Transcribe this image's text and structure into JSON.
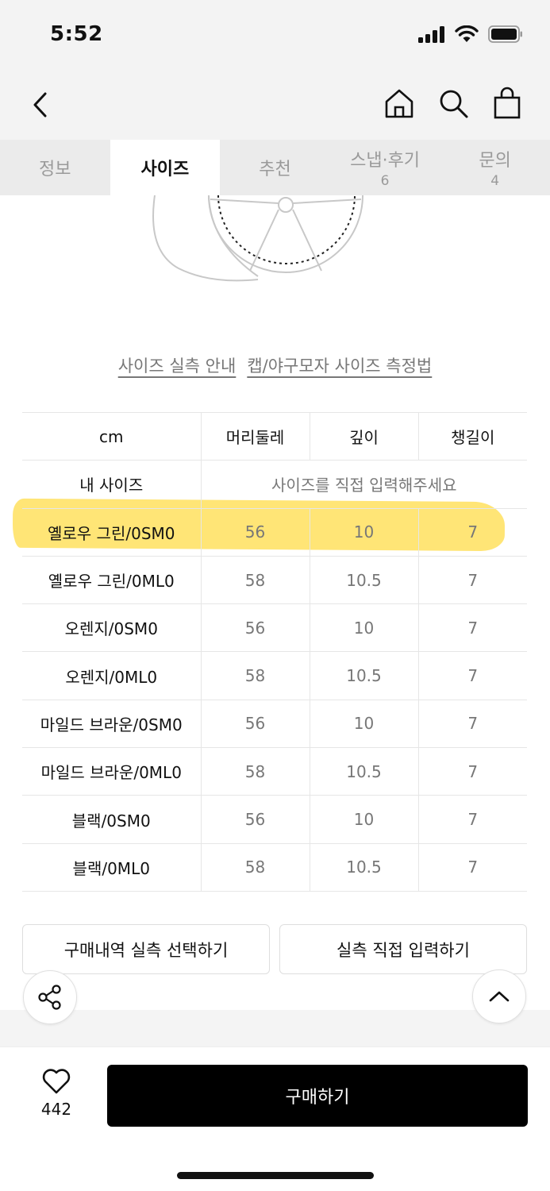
{
  "status_bar": {
    "time": "5:52",
    "icons": [
      "signal-icon",
      "wifi-icon",
      "battery-icon"
    ]
  },
  "nav": {
    "icons": [
      "back-chevron-icon",
      "home-icon",
      "search-icon",
      "shopping-bag-icon"
    ]
  },
  "tabs": [
    {
      "label": "정보",
      "count": ""
    },
    {
      "label": "사이즈",
      "count": ""
    },
    {
      "label": "추천",
      "count": ""
    },
    {
      "label": "스냅·후기",
      "count": "6"
    },
    {
      "label": "문의",
      "count": "4"
    }
  ],
  "links": {
    "guide": "사이즈 실측 안내",
    "measure": "캡/야구모자 사이즈 측정법"
  },
  "table": {
    "headers": [
      "cm",
      "머리둘레",
      "깊이",
      "챙길이"
    ],
    "my_size_label": "내 사이즈",
    "my_size_placeholder": "사이즈를 직접 입력해주세요",
    "rows": [
      {
        "name": "옐로우 그린/0SM0",
        "v1": "56",
        "v2": "10",
        "v3": "7"
      },
      {
        "name": "옐로우 그린/0ML0",
        "v1": "58",
        "v2": "10.5",
        "v3": "7"
      },
      {
        "name": "오렌지/0SM0",
        "v1": "56",
        "v2": "10",
        "v3": "7"
      },
      {
        "name": "오렌지/0ML0",
        "v1": "58",
        "v2": "10.5",
        "v3": "7"
      },
      {
        "name": "마일드 브라운/0SM0",
        "v1": "56",
        "v2": "10",
        "v3": "7"
      },
      {
        "name": "마일드 브라운/0ML0",
        "v1": "58",
        "v2": "10.5",
        "v3": "7"
      },
      {
        "name": "블랙/0SM0",
        "v1": "56",
        "v2": "10",
        "v3": "7"
      },
      {
        "name": "블랙/0ML0",
        "v1": "58",
        "v2": "10.5",
        "v3": "7"
      }
    ],
    "highlight_color": "#ffe05e"
  },
  "actions": {
    "purchase_history": "구매내역 실측 선택하기",
    "direct_input": "실측 직접 입력하기"
  },
  "bottom": {
    "like_count": "442",
    "buy_label": "구매하기"
  }
}
